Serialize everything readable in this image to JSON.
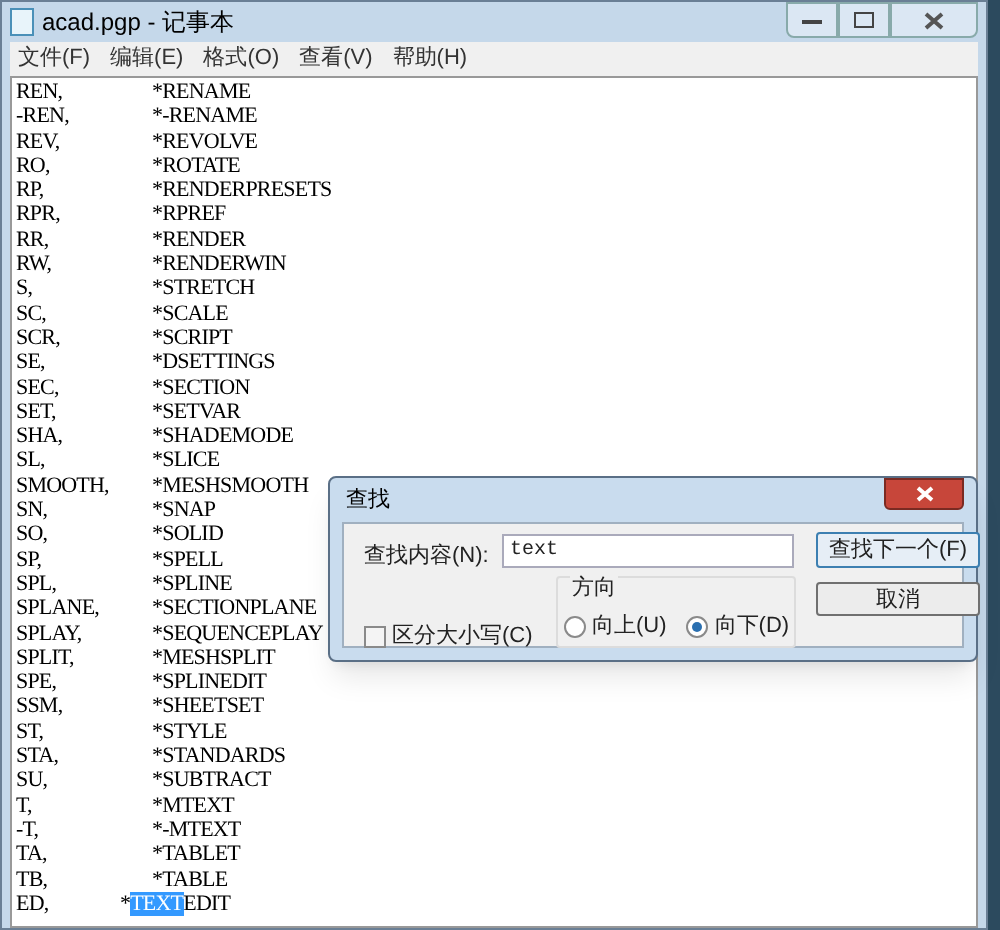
{
  "window": {
    "title": "acad.pgp - 记事本"
  },
  "menu": [
    "文件(F)",
    "编辑(E)",
    "格式(O)",
    "查看(V)",
    "帮助(H)"
  ],
  "lines": [
    {
      "alias": "REN,",
      "command": "*RENAME"
    },
    {
      "alias": "-REN,",
      "command": "*-RENAME"
    },
    {
      "alias": "REV,",
      "command": "*REVOLVE"
    },
    {
      "alias": "RO,",
      "command": "*ROTATE"
    },
    {
      "alias": "RP,",
      "command": "*RENDERPRESETS"
    },
    {
      "alias": "RPR,",
      "command": "*RPREF"
    },
    {
      "alias": "RR,",
      "command": "*RENDER"
    },
    {
      "alias": "RW,",
      "command": "*RENDERWIN"
    },
    {
      "alias": "S,",
      "command": "*STRETCH"
    },
    {
      "alias": "SC,",
      "command": "*SCALE"
    },
    {
      "alias": "SCR,",
      "command": "*SCRIPT"
    },
    {
      "alias": "SE,",
      "command": "*DSETTINGS"
    },
    {
      "alias": "SEC,",
      "command": "*SECTION"
    },
    {
      "alias": "SET,",
      "command": "*SETVAR"
    },
    {
      "alias": "SHA,",
      "command": "*SHADEMODE"
    },
    {
      "alias": "SL,",
      "command": "*SLICE"
    },
    {
      "alias": "SMOOTH,",
      "command": "*MESHSMOOTH"
    },
    {
      "alias": "SN,",
      "command": "*SNAP"
    },
    {
      "alias": "SO,",
      "command": "*SOLID"
    },
    {
      "alias": "SP,",
      "command": "*SPELL"
    },
    {
      "alias": "SPL,",
      "command": "*SPLINE"
    },
    {
      "alias": "SPLANE,",
      "command": "*SECTIONPLANE"
    },
    {
      "alias": "SPLAY,",
      "command": "*SEQUENCEPLAY"
    },
    {
      "alias": "SPLIT,",
      "command": "*MESHSPLIT"
    },
    {
      "alias": "SPE,",
      "command": "*SPLINEDIT"
    },
    {
      "alias": "SSM,",
      "command": "*SHEETSET"
    },
    {
      "alias": "ST,",
      "command": "*STYLE"
    },
    {
      "alias": "STA,",
      "command": "*STANDARDS"
    },
    {
      "alias": "SU,",
      "command": "*SUBTRACT"
    },
    {
      "alias": "T,",
      "command": "*MTEXT"
    },
    {
      "alias": "-T,",
      "command": "*-MTEXT"
    },
    {
      "alias": "TA,",
      "command": "*TABLET"
    },
    {
      "alias": "TB,",
      "command": "*TABLE"
    },
    {
      "alias": "ED,",
      "command_before": "*",
      "selected_text": "TEXT",
      "command_after": "EDIT"
    }
  ],
  "find_dialog": {
    "title": "查找",
    "find_label": "查找内容(N):",
    "find_value": "text",
    "find_next_button": "查找下一个(F)",
    "cancel_button": "取消",
    "match_case": {
      "label": "区分大小写(C)",
      "checked": false
    },
    "direction": {
      "label": "方向",
      "options": [
        {
          "label": "向上(U)",
          "selected": false
        },
        {
          "label": "向下(D)",
          "selected": true
        }
      ]
    }
  }
}
